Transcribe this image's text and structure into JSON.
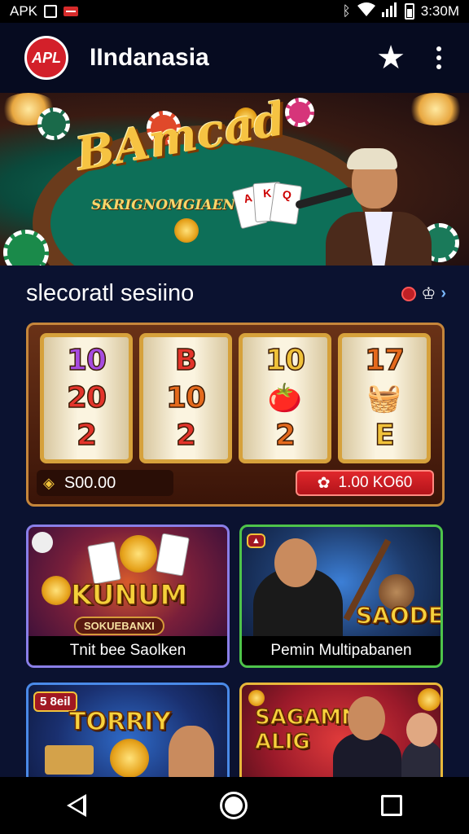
{
  "status_bar": {
    "left_text": "APK",
    "time": "3:30M",
    "icons": [
      "screenshot-icon",
      "flag-icon",
      "bluetooth-icon",
      "wifi-icon",
      "signal-icon",
      "battery-icon"
    ]
  },
  "app_bar": {
    "logo_text": "APL",
    "title": "IIndanasia",
    "actions": [
      "favorite-star-icon",
      "overflow-menu-icon"
    ]
  },
  "hero": {
    "title": "BAmcad",
    "subtitle": "SKRIGNOMGIAEN",
    "card_labels": [
      "A",
      "K",
      "Q"
    ]
  },
  "section": {
    "title": "slecoratl sesiino"
  },
  "slot_machine": {
    "reels": [
      [
        "10",
        "20",
        "2"
      ],
      [
        "B",
        "10",
        "2"
      ],
      [
        "10",
        "fruit",
        "2"
      ],
      [
        "17",
        "basket",
        "E"
      ]
    ],
    "balance": "S00.00",
    "spin_label": "1.00 KO60"
  },
  "games": [
    {
      "label": "Tnit bee Saolken",
      "art_title": "KUNUM",
      "art_sub": "SOKUEBANXI",
      "badge": ""
    },
    {
      "label": "Pemin Multipabanen",
      "art_title": "SAODE",
      "art_sub": "",
      "badge": ""
    },
    {
      "label": "",
      "art_title": "TORRIY",
      "art_sub": "",
      "badge": "5 8eil"
    },
    {
      "label": "",
      "art_title": "SAGAMN ALIG",
      "art_sub": "",
      "badge": ""
    }
  ],
  "colors": {
    "background": "#0b1230",
    "accent_red": "#d3202a",
    "gold": "#f6c342",
    "card_border_1": "#8a7fe8",
    "card_border_2": "#4ec44a",
    "card_border_3": "#4a8ae8",
    "card_border_4": "#e8b83a"
  },
  "nav_bar": {
    "buttons": [
      "back-icon",
      "home-icon",
      "recents-icon"
    ]
  }
}
